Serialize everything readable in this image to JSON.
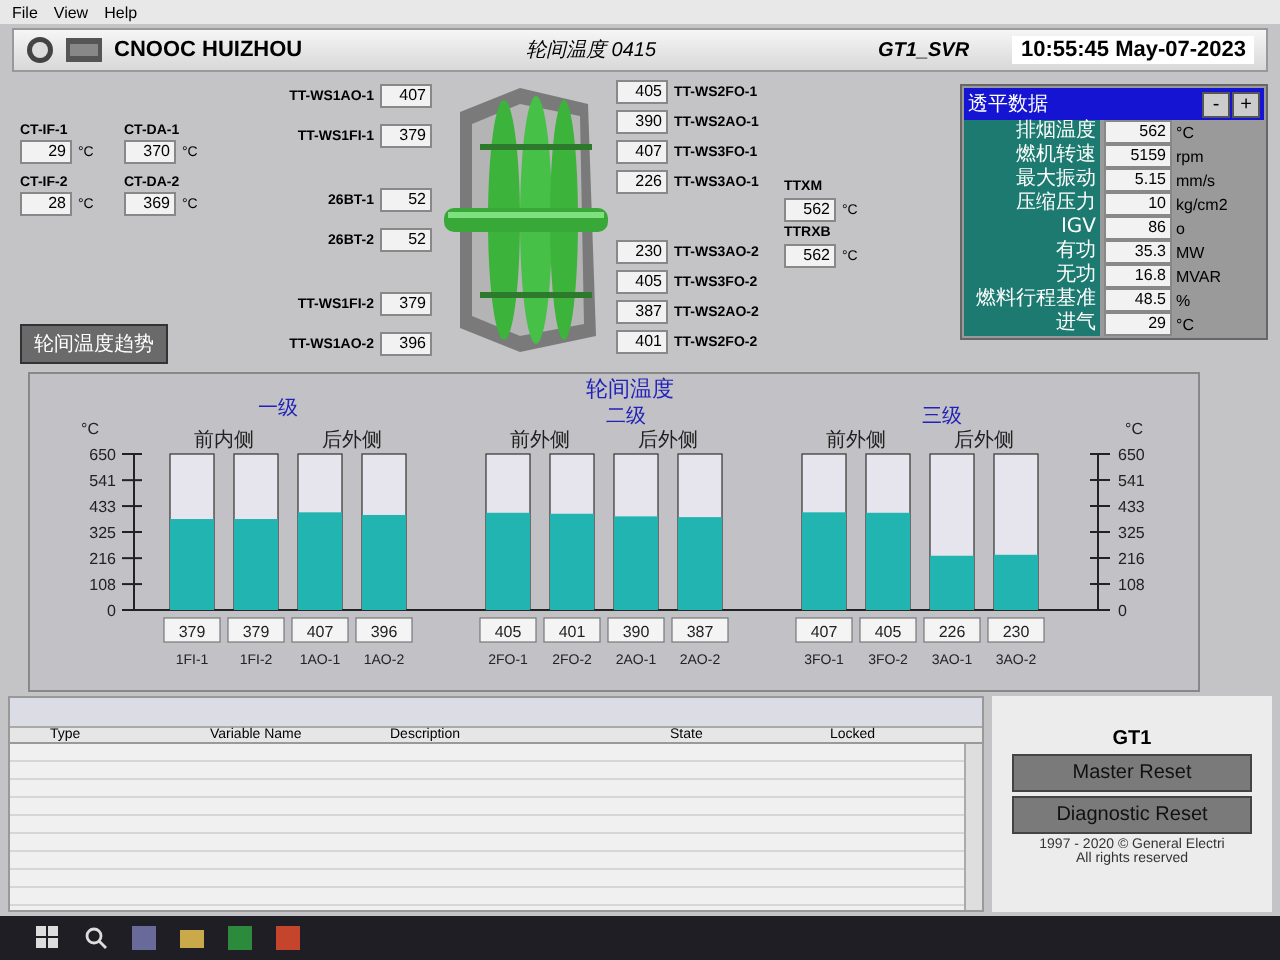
{
  "menu": [
    "File",
    "View",
    "Help"
  ],
  "header": {
    "company": "CNOOC HUIZHOU",
    "screen_title": "轮间温度 0415",
    "server": "GT1_SVR",
    "time": "10:55:45",
    "date": "May-07-2023"
  },
  "cooling": [
    {
      "name": "CT-IF-1",
      "value": "29",
      "unit": "°C"
    },
    {
      "name": "CT-DA-1",
      "value": "370",
      "unit": "°C"
    },
    {
      "name": "CT-IF-2",
      "value": "28",
      "unit": "°C"
    },
    {
      "name": "CT-DA-2",
      "value": "369",
      "unit": "°C"
    }
  ],
  "trend_button": "轮间温度趋势",
  "left_tags": [
    {
      "name": "TT-WS1AO-1",
      "value": "407"
    },
    {
      "name": "TT-WS1FI-1",
      "value": "379"
    },
    {
      "name": "26BT-1",
      "value": "52"
    },
    {
      "name": "26BT-2",
      "value": "52"
    },
    {
      "name": "TT-WS1FI-2",
      "value": "379"
    },
    {
      "name": "TT-WS1AO-2",
      "value": "396"
    }
  ],
  "right_tags": [
    {
      "name": "TT-WS2FO-1",
      "value": "405"
    },
    {
      "name": "TT-WS2AO-1",
      "value": "390"
    },
    {
      "name": "TT-WS3FO-1",
      "value": "407"
    },
    {
      "name": "TT-WS3AO-1",
      "value": "226"
    },
    {
      "name": "TT-WS3AO-2",
      "value": "230"
    },
    {
      "name": "TT-WS3FO-2",
      "value": "405"
    },
    {
      "name": "TT-WS2AO-2",
      "value": "387"
    },
    {
      "name": "TT-WS2FO-2",
      "value": "401"
    }
  ],
  "exhaust": [
    {
      "name": "TTXM",
      "value": "562",
      "unit": "°C"
    },
    {
      "name": "TTRXB",
      "value": "562",
      "unit": "°C"
    }
  ],
  "turbine_panel": {
    "title": "透平数据",
    "buttons": [
      "-",
      "+"
    ],
    "rows": [
      {
        "label": "排烟温度",
        "value": "562",
        "unit": "°C"
      },
      {
        "label": "燃机转速",
        "value": "5159",
        "unit": "rpm"
      },
      {
        "label": "最大振动",
        "value": "5.15",
        "unit": "mm/s"
      },
      {
        "label": "压缩压力",
        "value": "10",
        "unit": "kg/cm2"
      },
      {
        "label": "IGV",
        "value": "86",
        "unit": "o"
      },
      {
        "label": "有功",
        "value": "35.3",
        "unit": "MW"
      },
      {
        "label": "无功",
        "value": "16.8",
        "unit": "MVAR"
      },
      {
        "label": "燃料行程基准",
        "value": "48.5",
        "unit": "%"
      },
      {
        "label": "进气",
        "value": "29",
        "unit": "°C"
      }
    ]
  },
  "wheel_chart": {
    "stages": [
      {
        "label": "一级",
        "sides": [
          "前内侧",
          "后外侧"
        ]
      },
      {
        "label": "二级",
        "sides": [
          "前外侧",
          "后外侧"
        ]
      },
      {
        "label": "三级",
        "sides": [
          "前外侧",
          "后外侧"
        ]
      }
    ],
    "chart_data": {
      "type": "bar",
      "title": "轮间温度",
      "ylabel": "°C",
      "categories": [
        "1FI-1",
        "1FI-2",
        "1AO-1",
        "1AO-2",
        "2FO-1",
        "2FO-2",
        "2AO-1",
        "2AO-2",
        "3FO-1",
        "3FO-2",
        "3AO-1",
        "3AO-2"
      ],
      "values": [
        379,
        379,
        407,
        396,
        405,
        401,
        390,
        387,
        407,
        405,
        226,
        230
      ],
      "ylim": [
        0,
        650
      ],
      "yticks": [
        0,
        108,
        216,
        325,
        433,
        541,
        650
      ],
      "data_labels": true
    },
    "left_axis": {
      "ticks": [
        "650",
        "541",
        "433",
        "325",
        "216",
        "108",
        "0"
      ]
    },
    "right_axis": {
      "unit": "°C",
      "ticks": [
        "650",
        "541",
        "433",
        "325",
        "216",
        "108",
        "0"
      ]
    }
  },
  "alarm_viewer": {
    "columns": [
      "Type",
      "Variable Name",
      "Description",
      "State",
      "Locked"
    ]
  },
  "unit_panel": {
    "unit": "GT1",
    "buttons": [
      "Master Reset",
      "Diagnostic Reset"
    ],
    "copyright": [
      "1997 - 2020 © General Electri",
      "All rights reserved"
    ]
  }
}
